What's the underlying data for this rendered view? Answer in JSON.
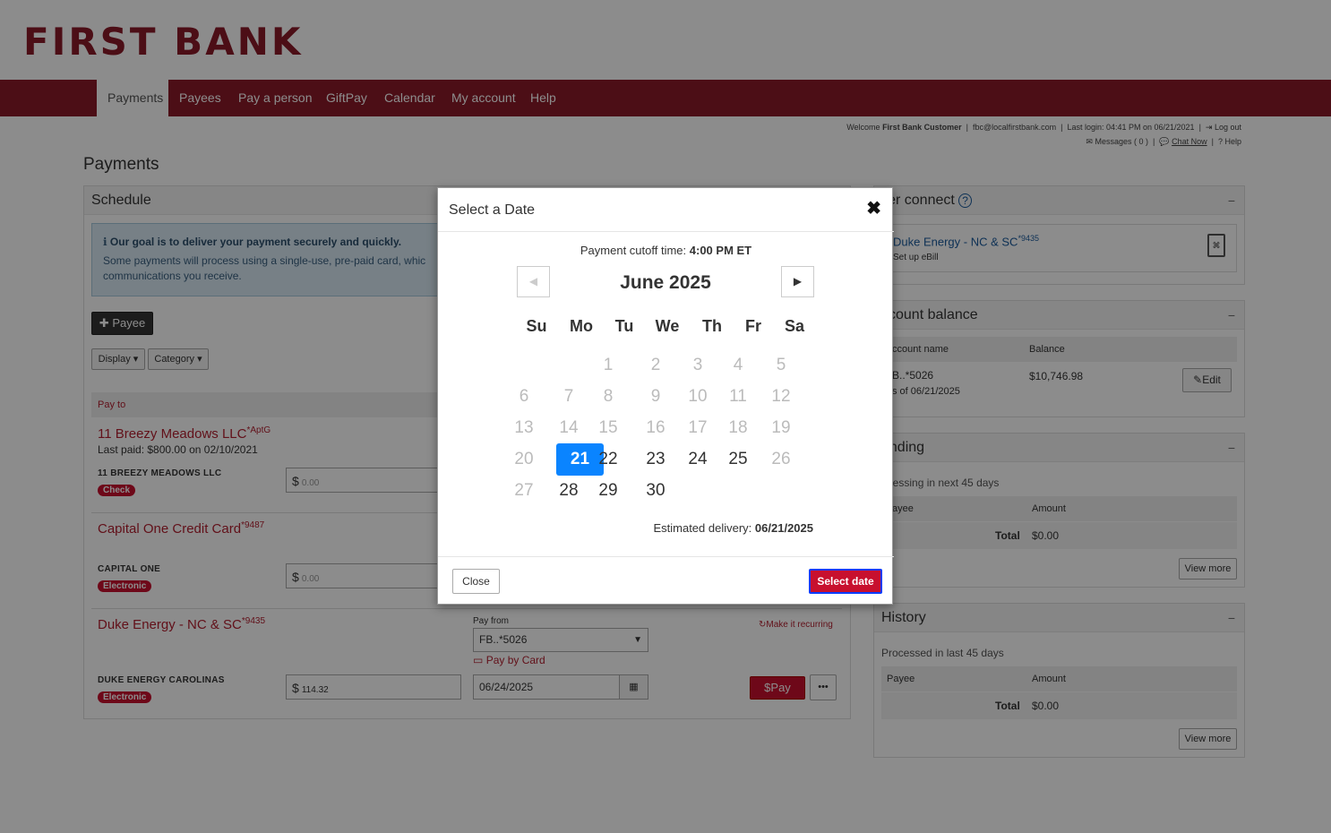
{
  "brand": {
    "logo_text": "FIRST BANK"
  },
  "nav": {
    "items": [
      "Payments",
      "Payees",
      "Pay a person",
      "GiftPay",
      "Calendar",
      "My account",
      "Help"
    ]
  },
  "topinfo": {
    "welcome": "Welcome",
    "customer": "First Bank Customer",
    "email": "fbc@localfirstbank.com",
    "last_login": "Last login: 04:41 PM on 06/21/2021",
    "logout": "Log out",
    "messages": "Messages ( 0 )",
    "chat": "Chat Now",
    "help": "Help"
  },
  "page_title": "Payments",
  "schedule": {
    "title": "Schedule",
    "info_title": "Our goal is to deliver your payment securely and quickly.",
    "info_text": "Some payments will process using a single-use, pre-paid card, which ... communications you receive.",
    "info_line1": "Some payments will process using a single-use, pre-paid card, whic",
    "info_line2": "communications you receive.",
    "add_payee": "Payee",
    "display": "Display",
    "category": "Category",
    "pay_to": "Pay to",
    "payees": [
      {
        "name": "11 Breezy Meadows LLC",
        "suffix": "*AptG",
        "last_paid": "Last paid: $800.00 on 02/10/2021",
        "caps": "11 BREEZY MEADOWS LLC",
        "method": "Check",
        "amount": "0.00"
      },
      {
        "name": "Capital One Credit Card",
        "suffix": "*9487",
        "caps": "CAPITAL ONE",
        "method": "Electronic",
        "amount": "0.00"
      },
      {
        "name": "Duke Energy - NC & SC",
        "suffix": "*9435",
        "caps": "DUKE ENERGY CAROLINAS",
        "method": "Electronic",
        "amount": "114.32"
      }
    ],
    "pay_from_label": "Pay from",
    "pay_from_value": "FB..*5026",
    "pay_by_card": "Pay by Card",
    "date_value": "06/24/2025",
    "make_recurring": "Make it recurring",
    "pay_button": "Pay",
    "dollar": "$"
  },
  "biller_connect": {
    "title": "ller connect",
    "item": "Duke Energy - NC & SC",
    "item_suffix": "*9435",
    "setup": "Set up eBill"
  },
  "account_balance": {
    "title": "ccount balance",
    "col_name": "ccount name",
    "col_balance": "Balance",
    "account": "B..*5026",
    "as_of": "s of 06/21/2025",
    "balance": "$10,746.98",
    "edit": "Edit"
  },
  "pending": {
    "title": "ending",
    "subtitle": "ocessing in next 45 days",
    "col_payee": "ayee",
    "col_amount": "Amount",
    "total_label": "Total",
    "total_value": "$0.00",
    "view_more": "View more"
  },
  "history": {
    "title": "History",
    "subtitle": "Processed in last 45 days",
    "col_payee": "Payee",
    "col_amount": "Amount",
    "total_label": "Total",
    "total_value": "$0.00",
    "view_more": "View more"
  },
  "modal": {
    "title": "Select a Date",
    "cutoff_label": "Payment cutoff time:",
    "cutoff_value": "4:00 PM ET",
    "month": "June 2025",
    "weekdays": [
      "Su",
      "Mo",
      "Tu",
      "We",
      "Th",
      "Fr",
      "Sa"
    ],
    "delivery_label": "Estimated delivery:",
    "delivery_value": "06/21/2025",
    "close": "Close",
    "select": "Select date",
    "days": [
      [
        "",
        "",
        "1",
        "2",
        "3",
        "4",
        "5"
      ],
      [
        "6",
        "7",
        "8",
        "9",
        "10",
        "11",
        "12"
      ],
      [
        "13",
        "14",
        "15",
        "16",
        "17",
        "18",
        "19"
      ],
      [
        "20",
        "21",
        "22",
        "23",
        "24",
        "25",
        "26"
      ],
      [
        "27",
        "28",
        "29",
        "30",
        "",
        "",
        ""
      ]
    ],
    "selected_day": "21"
  }
}
